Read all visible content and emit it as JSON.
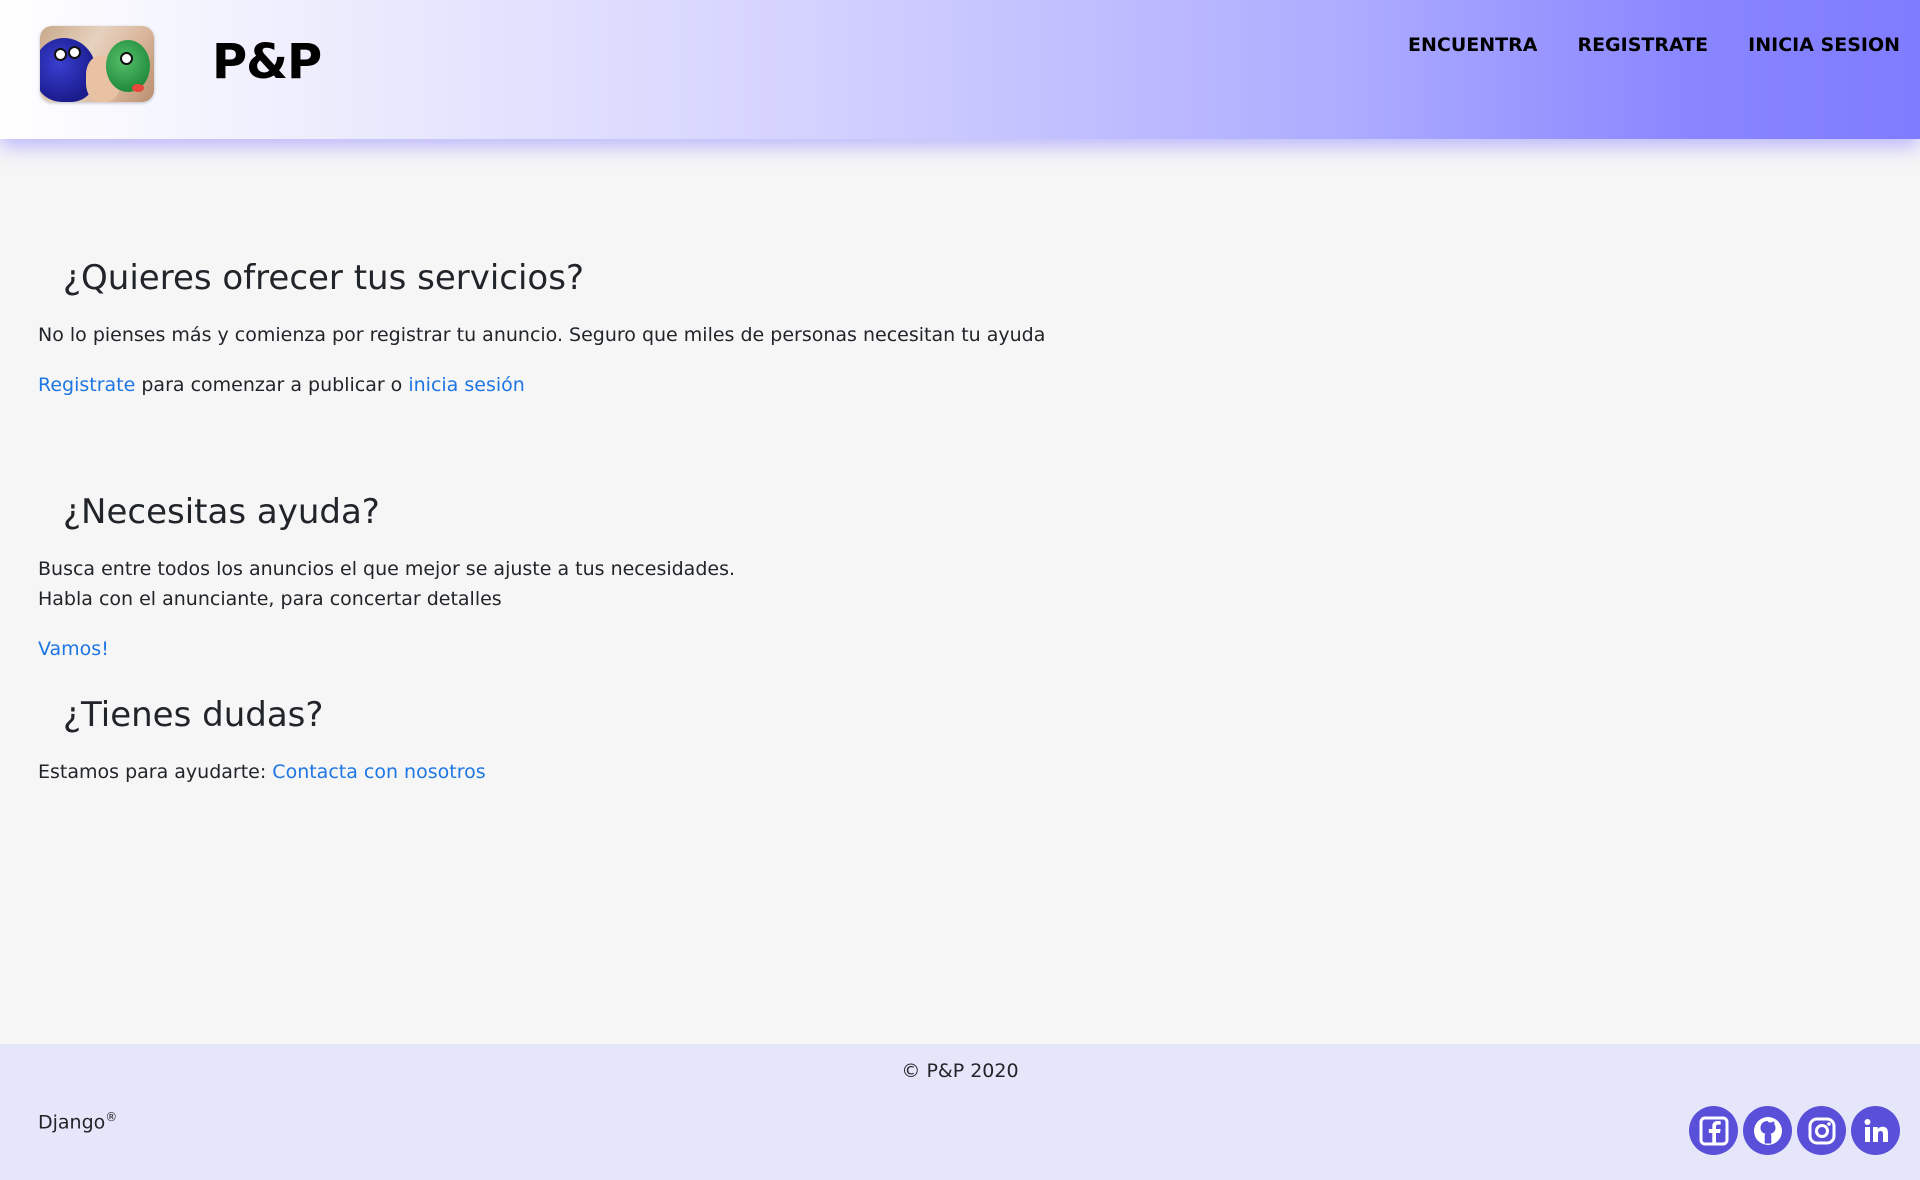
{
  "header": {
    "brand": "P&P",
    "nav": [
      {
        "label": "ENCUENTRA"
      },
      {
        "label": "REGISTRATE"
      },
      {
        "label": "INICIA SESION"
      }
    ]
  },
  "sections": [
    {
      "title": "¿Quieres ofrecer tus servicios?",
      "text": "No lo pienses más y comienza por registrar tu anuncio. Seguro que miles de personas necesitan tu ayuda",
      "cta_link1": "Registrate",
      "cta_middle": " para comenzar a publicar o ",
      "cta_link2": "inicia sesión"
    },
    {
      "title": "¿Necesitas ayuda?",
      "line1": "Busca entre todos los anuncios el que mejor se ajuste a tus necesidades.",
      "line2": "Habla con el anunciante, para concertar detalles",
      "cta_link": "Vamos!"
    },
    {
      "title": "¿Tienes dudas?",
      "text_prefix": "Estamos para ayudarte: ",
      "cta_link": "Contacta con nosotros"
    }
  ],
  "footer": {
    "copyright": "© P&P 2020",
    "django": "Django",
    "django_mark": "®",
    "social": [
      {
        "icon": "facebook-icon"
      },
      {
        "icon": "github-icon"
      },
      {
        "icon": "instagram-icon"
      },
      {
        "icon": "linkedin-icon"
      }
    ]
  },
  "colors": {
    "link": "#1e76e3",
    "social": "#5a4fd8",
    "footer_bg": "#e6e6fa",
    "header_gradient_end": "#7f7cff"
  }
}
